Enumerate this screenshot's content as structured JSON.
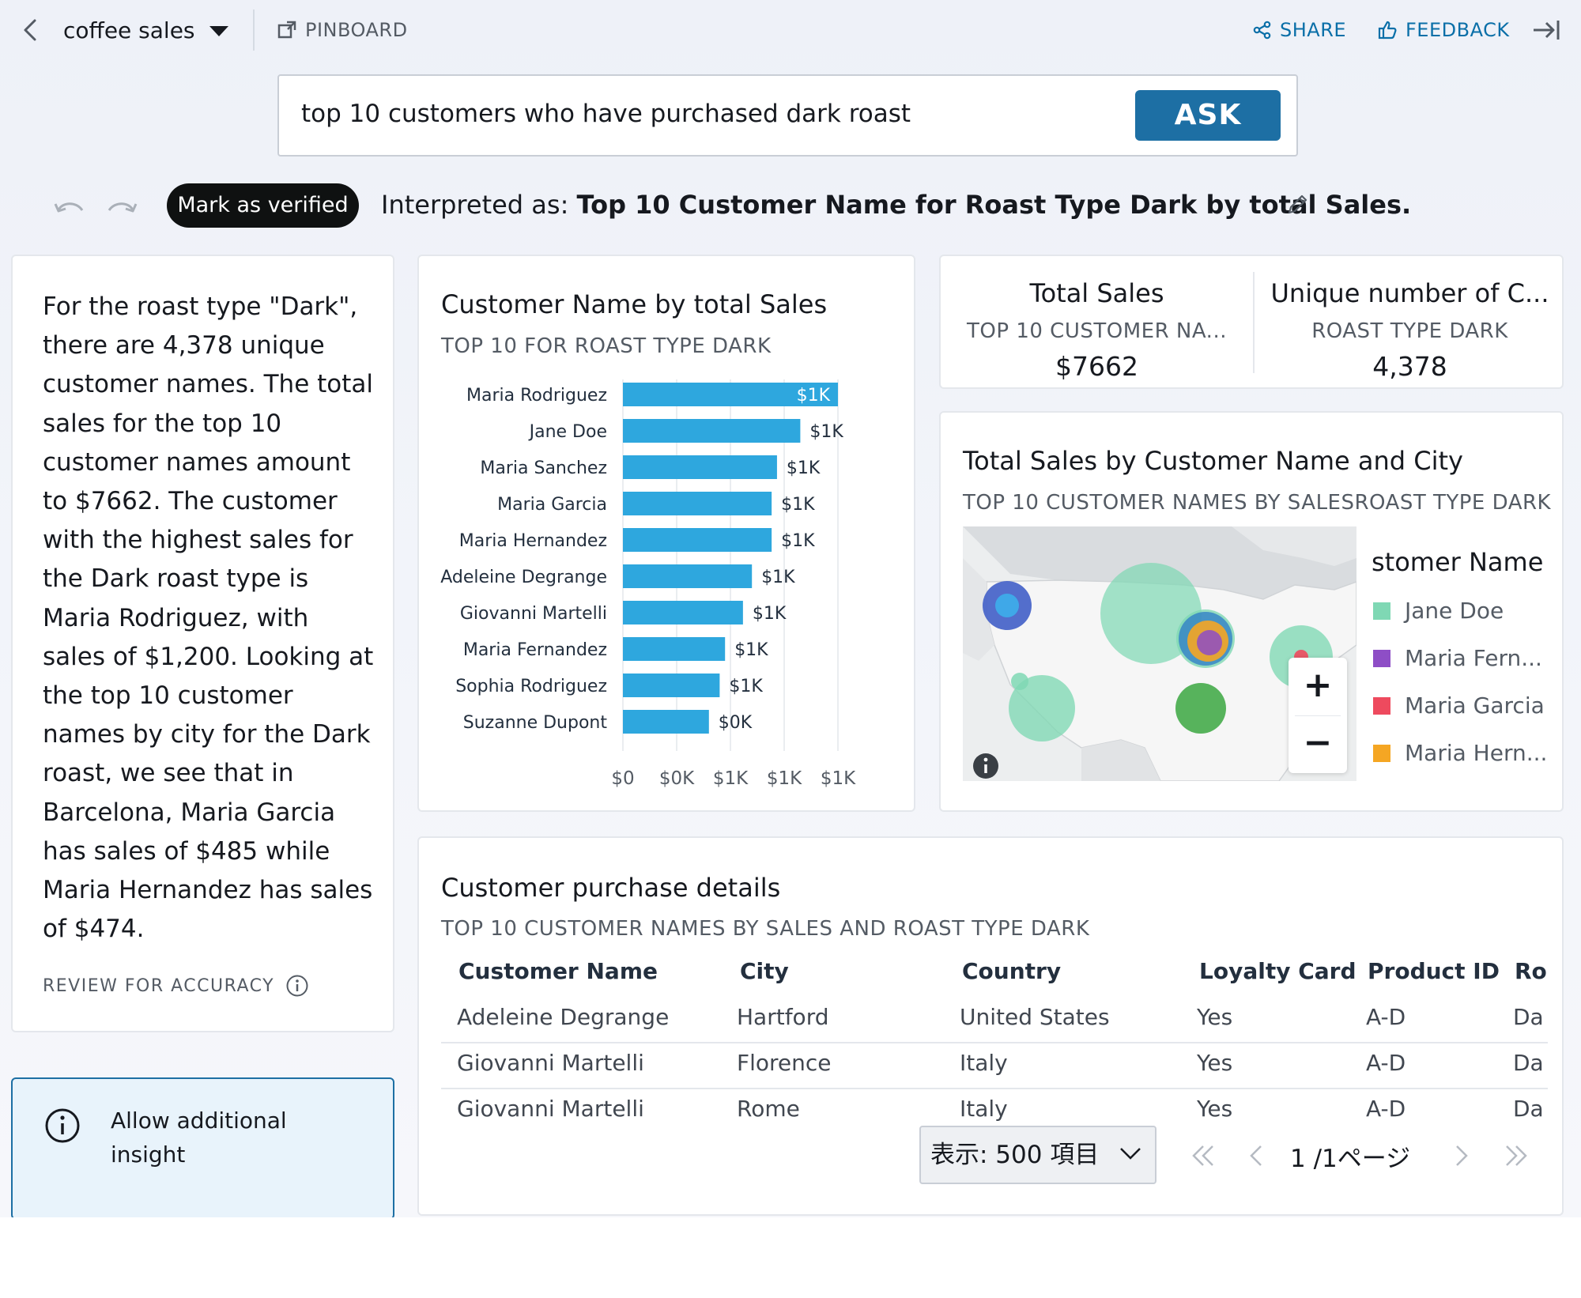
{
  "topbar": {
    "dataset": "coffee sales",
    "pinboard": "PINBOARD",
    "share": "SHARE",
    "feedback": "FEEDBACK"
  },
  "search": {
    "query": "top 10 customers who have purchased dark roast",
    "ask_label": "ASK"
  },
  "interpretation": {
    "verify_label": "Mark as verified",
    "prefix": "Interpreted as: ",
    "text": "Top 10 Customer Name for Roast Type Dark by total Sales."
  },
  "narrative": {
    "text": "For the roast type \"Dark\", there are 4,378 unique customer names. The total sales for the top 10 customer names amount to $7662. The customer with the highest sales for the Dark roast type is Maria Rodriguez, with sales of $1,200. Looking at the top 10 customer names by city for the Dark roast, we see that in Barcelona, Maria Garcia has sales of $485 while Maria Hernandez has sales of $474.",
    "review": "REVIEW FOR ACCURACY"
  },
  "insight": {
    "text": "Allow additional insight"
  },
  "bar_card": {
    "title": "Customer Name by total Sales",
    "subtitle": "TOP 10 FOR ROAST TYPE DARK"
  },
  "chart_data": {
    "type": "bar",
    "orientation": "horizontal",
    "title": "Customer Name by total Sales",
    "subtitle": "TOP 10 FOR ROAST TYPE DARK",
    "categories": [
      "Maria Rodriguez",
      "Jane Doe",
      "Maria Sanchez",
      "Maria Garcia",
      "Maria Hernandez",
      "Adeleine Degrange",
      "Giovanni Martelli",
      "Maria Fernandez",
      "Sophia Rodriguez",
      "Suzanne Dupont"
    ],
    "values": [
      1200,
      990,
      860,
      830,
      830,
      720,
      670,
      570,
      540,
      480
    ],
    "data_labels": [
      "$1K",
      "$1K",
      "$1K",
      "$1K",
      "$1K",
      "$1K",
      "$1K",
      "$1K",
      "$1K",
      "$0K"
    ],
    "x_ticks": [
      "$0",
      "$0K",
      "$1K",
      "$1K",
      "$1K"
    ],
    "xlim": [
      0,
      1200
    ],
    "grid": true,
    "color": "#2ea7de"
  },
  "kpis": [
    {
      "title": "Total Sales",
      "subtitle": "TOP 10 CUSTOMER NA...",
      "value": "$7662"
    },
    {
      "title": "Unique number of C...",
      "subtitle": "ROAST TYPE DARK",
      "value": "4,378"
    }
  ],
  "map_card": {
    "title": "Total Sales by Customer Name and City",
    "subtitle": "TOP 10 CUSTOMER NAMES BY SALESROAST TYPE DARK",
    "legend_title": "stomer Name",
    "legend": [
      {
        "label": "Jane Doe",
        "color": "#7fd8b4"
      },
      {
        "label": "Maria Fern...",
        "color": "#8e4ec6"
      },
      {
        "label": "Maria Garcia",
        "color": "#ee4a5e"
      },
      {
        "label": "Maria Hern...",
        "color": "#f5a623"
      }
    ],
    "zoom_in": "+",
    "zoom_out": "−"
  },
  "table_card": {
    "title": "Customer purchase details",
    "subtitle": "TOP 10 CUSTOMER NAMES BY SALES AND ROAST TYPE DARK",
    "headers": [
      "Customer Name",
      "City",
      "Country",
      "Loyalty Card",
      "Product ID",
      "Ro"
    ],
    "rows": [
      [
        "Adeleine Degrange",
        "Hartford",
        "United States",
        "Yes",
        "A-D",
        "Da"
      ],
      [
        "Giovanni Martelli",
        "Florence",
        "Italy",
        "Yes",
        "A-D",
        "Da"
      ],
      [
        "Giovanni Martelli",
        "Rome",
        "Italy",
        "Yes",
        "A-D",
        "Da"
      ]
    ]
  },
  "pager": {
    "page_size": "表示: 500 項目",
    "page_text": "1  /1ページ"
  }
}
